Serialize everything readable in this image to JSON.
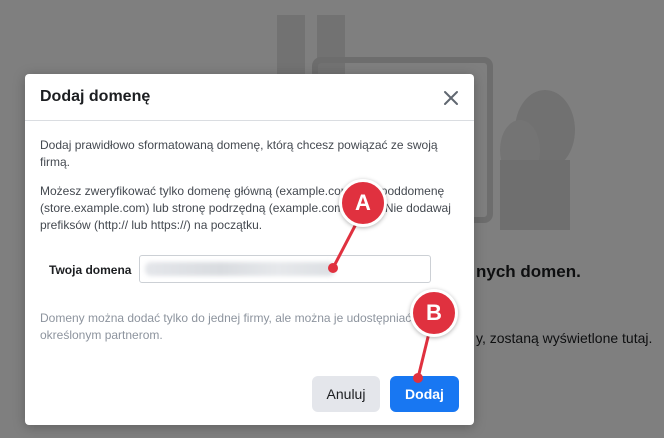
{
  "background": {
    "heading": "nych domen.",
    "text": "y, zostaną wyświetlone tutaj."
  },
  "dialog": {
    "title": "Dodaj domenę",
    "intro": "Dodaj prawidłowo sformatowaną domenę, którą chcesz powiązać ze swoją firmą.",
    "info": "Możesz zweryfikować tylko domenę główną (example.com), nie poddomenę (store.example.com) lub stronę podrzędną (example.com/page). Nie dodawaj prefiksów (http:// lub https://) na początku.",
    "field_label": "Twoja domena",
    "field_value": "",
    "note": "Domeny można dodać tylko do jednej firmy, ale można je udostępniać określonym partnerom.",
    "cancel_label": "Anuluj",
    "add_label": "Dodaj"
  },
  "markers": {
    "a": "A",
    "b": "B"
  },
  "colors": {
    "primary": "#1877f2",
    "marker": "#e0313f"
  }
}
